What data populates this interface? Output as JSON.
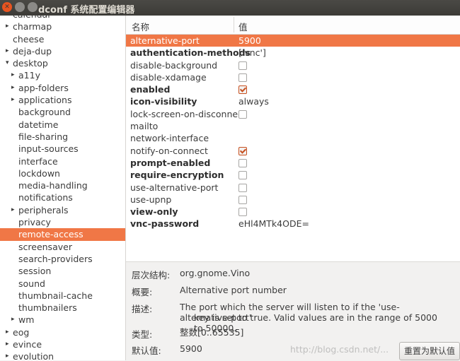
{
  "window": {
    "title": "dconf 系统配置编辑器",
    "controls": [
      "close",
      "minimize",
      "maximize"
    ]
  },
  "tree": {
    "rows": [
      {
        "label": "calendar",
        "level": 0,
        "arrow": ""
      },
      {
        "label": "charmap",
        "level": 0,
        "arrow": "▸"
      },
      {
        "label": "cheese",
        "level": 0,
        "arrow": ""
      },
      {
        "label": "deja-dup",
        "level": 0,
        "arrow": "▸"
      },
      {
        "label": "desktop",
        "level": 0,
        "arrow": "▾"
      },
      {
        "label": "a11y",
        "level": 1,
        "arrow": "▸"
      },
      {
        "label": "app-folders",
        "level": 1,
        "arrow": "▸"
      },
      {
        "label": "applications",
        "level": 1,
        "arrow": "▸"
      },
      {
        "label": "background",
        "level": 1,
        "arrow": ""
      },
      {
        "label": "datetime",
        "level": 1,
        "arrow": ""
      },
      {
        "label": "file-sharing",
        "level": 1,
        "arrow": ""
      },
      {
        "label": "input-sources",
        "level": 1,
        "arrow": ""
      },
      {
        "label": "interface",
        "level": 1,
        "arrow": ""
      },
      {
        "label": "lockdown",
        "level": 1,
        "arrow": ""
      },
      {
        "label": "media-handling",
        "level": 1,
        "arrow": ""
      },
      {
        "label": "notifications",
        "level": 1,
        "arrow": ""
      },
      {
        "label": "peripherals",
        "level": 1,
        "arrow": "▸"
      },
      {
        "label": "privacy",
        "level": 1,
        "arrow": ""
      },
      {
        "label": "remote-access",
        "level": 1,
        "arrow": "",
        "selected": true
      },
      {
        "label": "screensaver",
        "level": 1,
        "arrow": ""
      },
      {
        "label": "search-providers",
        "level": 1,
        "arrow": ""
      },
      {
        "label": "session",
        "level": 1,
        "arrow": ""
      },
      {
        "label": "sound",
        "level": 1,
        "arrow": ""
      },
      {
        "label": "thumbnail-cache",
        "level": 1,
        "arrow": ""
      },
      {
        "label": "thumbnailers",
        "level": 1,
        "arrow": ""
      },
      {
        "label": "wm",
        "level": 1,
        "arrow": "▸"
      },
      {
        "label": "eog",
        "level": 0,
        "arrow": "▸"
      },
      {
        "label": "evince",
        "level": 0,
        "arrow": "▸"
      },
      {
        "label": "evolution",
        "level": 0,
        "arrow": "▸"
      }
    ]
  },
  "table": {
    "header_name": "名称",
    "header_value": "值",
    "rows": [
      {
        "key": "alternative-port",
        "bold": false,
        "type": "text",
        "value": "5900",
        "selected": true
      },
      {
        "key": "authentication-methods",
        "bold": true,
        "type": "text",
        "value": "['vnc']"
      },
      {
        "key": "disable-background",
        "bold": false,
        "type": "check",
        "checked": false
      },
      {
        "key": "disable-xdamage",
        "bold": false,
        "type": "check",
        "checked": false
      },
      {
        "key": "enabled",
        "bold": true,
        "type": "check",
        "checked": true
      },
      {
        "key": "icon-visibility",
        "bold": true,
        "type": "text",
        "value": "always"
      },
      {
        "key": "lock-screen-on-disconnect",
        "bold": false,
        "type": "check",
        "checked": false
      },
      {
        "key": "mailto",
        "bold": false,
        "type": "text",
        "value": ""
      },
      {
        "key": "network-interface",
        "bold": false,
        "type": "text",
        "value": ""
      },
      {
        "key": "notify-on-connect",
        "bold": false,
        "type": "check",
        "checked": true
      },
      {
        "key": "prompt-enabled",
        "bold": true,
        "type": "check",
        "checked": false
      },
      {
        "key": "require-encryption",
        "bold": true,
        "type": "check",
        "checked": false
      },
      {
        "key": "use-alternative-port",
        "bold": false,
        "type": "check",
        "checked": false
      },
      {
        "key": "use-upnp",
        "bold": false,
        "type": "check",
        "checked": false
      },
      {
        "key": "view-only",
        "bold": true,
        "type": "check",
        "checked": false
      },
      {
        "key": "vnc-password",
        "bold": true,
        "type": "text",
        "value": "eHl4MTk4ODE="
      }
    ]
  },
  "details": {
    "schema_label": "层次结构:",
    "schema_value": "org.gnome.Vino",
    "summary_label": "概要:",
    "summary_value": "Alternative port number",
    "description_label": "描述:",
    "description_line1": "The port which the server will listen to if the 'use-alternative-port'",
    "description_line2": "key is set to true. Valid values are in the range of 5000 to 50000.",
    "type_label": "类型:",
    "type_value": "整数[0..65535]",
    "default_label": "默认值:",
    "default_value": "5900",
    "reset_button": "重置为默认值"
  },
  "watermark": "http://blog.csdn.net/..."
}
